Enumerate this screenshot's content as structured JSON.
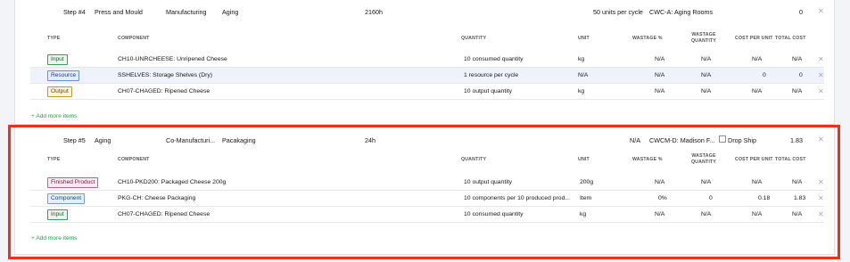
{
  "step4": {
    "step": "Step #4",
    "name": "Press and Mould",
    "type": "Manufacturing",
    "next": "Aging",
    "duration": "2160h",
    "rate": "50 units per cycle",
    "location": "CWC-A: Aging Rooms",
    "cost": "0",
    "items": [
      {
        "tag": "Input",
        "tag_color": "green",
        "component": "CH10-UNRCHEESE: Unripened Cheese",
        "quantity": "10 consumed quantity",
        "unit": "kg",
        "wastage_pct": "N/A",
        "wastage_qty": "N/A",
        "cost_per_unit": "N/A",
        "total": "N/A"
      },
      {
        "tag": "Resource",
        "tag_color": "blue",
        "component": "SSHELVES: Storage Shelves (Dry)",
        "quantity": "1 resource per cycle",
        "unit": "N/A",
        "wastage_pct": "N/A",
        "wastage_qty": "N/A",
        "cost_per_unit": "0",
        "total": "0"
      },
      {
        "tag": "Output",
        "tag_color": "yellow",
        "component": "CH07-CHAGED: Ripened Cheese",
        "quantity": "10 output quantity",
        "unit": "kg",
        "wastage_pct": "N/A",
        "wastage_qty": "N/A",
        "cost_per_unit": "N/A",
        "total": "N/A"
      }
    ],
    "add_more": "+ Add more items"
  },
  "step5": {
    "step": "Step #5",
    "name": "Aging",
    "type": "Co-Manufacturi...",
    "next": "Pacakaging",
    "duration": "24h",
    "rate": "N/A",
    "location": "CWCM-D: Madison F...",
    "drop_ship": "Drop Ship",
    "cost": "1.83",
    "items": [
      {
        "tag": "Finished Product",
        "tag_color": "pink",
        "component": "CH10-PKD200: Packaged Cheese 200g",
        "quantity": "10 output quantity",
        "unit": "200g",
        "wastage_pct": "N/A",
        "wastage_qty": "N/A",
        "cost_per_unit": "N/A",
        "total": "N/A"
      },
      {
        "tag": "Component",
        "tag_color": "lblue",
        "component": "PKG-CH: Cheese Packaging",
        "quantity": "10 components per 10 produced prod...",
        "unit": "Item",
        "wastage_pct": "0%",
        "wastage_qty": "0",
        "cost_per_unit": "0.18",
        "total": "1.83"
      },
      {
        "tag": "Input",
        "tag_color": "green",
        "component": "CH07-CHAGED: Ripened Cheese",
        "quantity": "10 consumed quantity",
        "unit": "kg",
        "wastage_pct": "N/A",
        "wastage_qty": "N/A",
        "cost_per_unit": "N/A",
        "total": "N/A"
      }
    ],
    "add_more": "+ Add more items"
  },
  "columns": {
    "type": "TYPE",
    "component": "COMPONENT",
    "quantity": "QUANTITY",
    "unit": "UNIT",
    "wastage_pct": "WASTAGE %",
    "wastage_qty_1": "WASTAGE",
    "wastage_qty_2": "QUANTITY",
    "cost_per_unit": "COST PER UNIT",
    "total_cost": "TOTAL COST"
  },
  "icons": {
    "remove": "close-icon"
  },
  "colors": {
    "highlight": "#e8321f",
    "link": "#24a148",
    "row_highlight": "#eef3fb"
  }
}
